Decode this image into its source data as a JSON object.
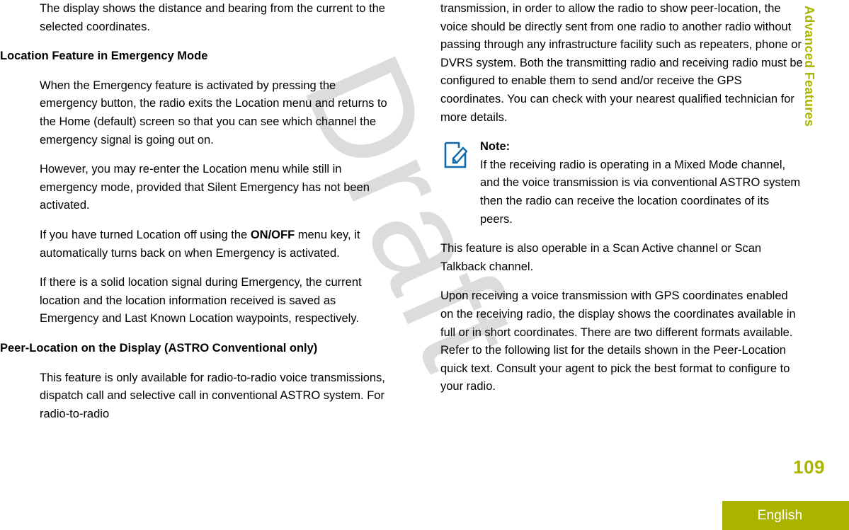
{
  "document": {
    "chapter_tab": "Advanced Features",
    "page_number": "109",
    "language": "English",
    "watermark": "Draft",
    "accent_color": "#aab400",
    "note_icon_color": "#1069ad"
  },
  "left_column": {
    "paragraph_1": "The display shows the distance and bearing from the current to the selected coordinates.",
    "heading_1": "Location Feature in Emergency Mode",
    "paragraph_2": "When the Emergency feature is activated by pressing the emergency button, the radio exits the Location menu and returns to the Home (default) screen so that you can see which channel the emergency signal is going out on.",
    "paragraph_3": "However, you may re-enter the Location menu while still in emergency mode, provided that Silent Emergency has not been activated.",
    "paragraph_4_part_1": "If you have turned Location off using the ",
    "paragraph_4_bold": "ON/OFF",
    "paragraph_4_part_2": " menu key, it automatically turns back on when Emergency is activated.",
    "paragraph_5": "If there is a solid location signal during Emergency, the current location and the location information received is saved as Emergency and Last Known Location waypoints, respectively.",
    "heading_2": "Peer-Location on the Display (ASTRO Conventional only)",
    "paragraph_6": "This feature is only available for radio-to-radio voice transmissions, dispatch call and selective call in conventional ASTRO system. For radio-to-radio"
  },
  "right_column": {
    "paragraph_1": "transmission, in order to allow the radio to show peer-location, the voice should be directly sent from one radio to another radio without passing through any infrastructure facility such as repeaters, phone or DVRS system. Both the transmitting radio and receiving radio must be configured to enable them to send and/or receive the GPS coordinates. You can check with your nearest qualified technician for more details.",
    "note_label": "Note:",
    "note_text": "If the receiving radio is operating in a Mixed Mode channel, and the voice transmission is via conventional ASTRO system then the radio can receive the location coordinates of its peers.",
    "paragraph_2": "This feature is also operable in a Scan Active channel or Scan Talkback channel.",
    "paragraph_3": "Upon receiving a voice transmission with GPS coordinates enabled on the receiving radio, the display shows the coordinates available in full or in short coordinates. There are two different formats available. Refer to the following list for the details shown in the Peer-Location quick text. Consult your agent to pick the best format to configure to your radio."
  }
}
